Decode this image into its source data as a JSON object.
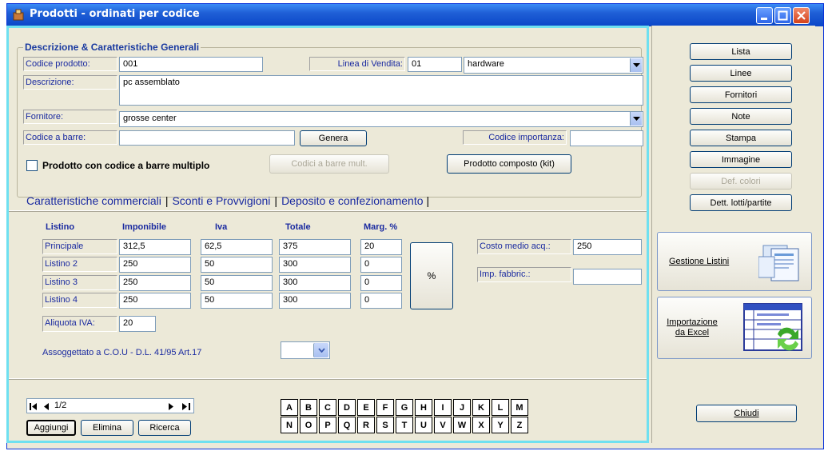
{
  "window": {
    "title": "Prodotti - ordinati per codice"
  },
  "general": {
    "legend": "Descrizione & Caratteristiche Generali",
    "codice_prodotto_label": "Codice prodotto:",
    "codice_prodotto_value": "001",
    "linea_vendita_label": "Linea di Vendita:",
    "linea_vendita_code": "01",
    "linea_vendita_name": "hardware",
    "descrizione_label": "Descrizione:",
    "descrizione_value": "pc assemblato",
    "fornitore_label": "Fornitore:",
    "fornitore_value": "grosse center",
    "codice_barre_label": "Codice a barre:",
    "codice_barre_value": "",
    "genera_button": "Genera",
    "codice_importanza_label": "Codice importanza:",
    "codice_importanza_value": "",
    "multiplo_checkbox": "Prodotto con codice a barre multiplo",
    "codici_barre_mult_button": "Codici a barre mult.",
    "prodotto_composto_button": "Prodotto composto (kit)"
  },
  "tabs": [
    {
      "label": "Caratteristiche commerciali"
    },
    {
      "label": "Sconti e Provvigioni"
    },
    {
      "label": "Deposito e confezionamento"
    }
  ],
  "pricing": {
    "headers": [
      "Listino",
      "Imponibile",
      "Iva",
      "Totale",
      "Marg. %"
    ],
    "rows": [
      {
        "name": "Principale",
        "imponibile": "312,5",
        "iva": "62,5",
        "totale": "375",
        "margine": "20"
      },
      {
        "name": "Listino 2",
        "imponibile": "250",
        "iva": "50",
        "totale": "300",
        "margine": "0"
      },
      {
        "name": "Listino 3",
        "imponibile": "250",
        "iva": "50",
        "totale": "300",
        "margine": "0"
      },
      {
        "name": "Listino 4",
        "imponibile": "250",
        "iva": "50",
        "totale": "300",
        "margine": "0"
      }
    ],
    "percent_button": "%",
    "aliquota_label": "Aliquota IVA:",
    "aliquota_value": "20",
    "costo_medio_label": "Costo medio acq.:",
    "costo_medio_value": "250",
    "imp_fabbric_label": "Imp. fabbric.:",
    "imp_fabbric_value": "",
    "cou_label": "Assoggettato a C.O.U  - D.L. 41/95 Art.17"
  },
  "navigator": {
    "position": "1/2",
    "aggiungi": "Aggiungi",
    "elimina": "Elimina",
    "ricerca": "Ricerca"
  },
  "letters_row1": [
    "A",
    "B",
    "C",
    "D",
    "E",
    "F",
    "G",
    "H",
    "I",
    "J",
    "K",
    "L",
    "M"
  ],
  "letters_row2": [
    "N",
    "O",
    "P",
    "Q",
    "R",
    "S",
    "T",
    "U",
    "V",
    "W",
    "X",
    "Y",
    "Z"
  ],
  "side": {
    "lista": "Lista",
    "linee": "Linee",
    "fornitori": "Fornitori",
    "note": "Note",
    "stampa": "Stampa",
    "immagine": "Immagine",
    "def_colori": "Def. colori",
    "dett_lotti": "Dett. lotti/partite",
    "gestione_listini": "Gestione Listini",
    "importazione": "Importazione da Excel",
    "chiudi": "Chiudi"
  }
}
